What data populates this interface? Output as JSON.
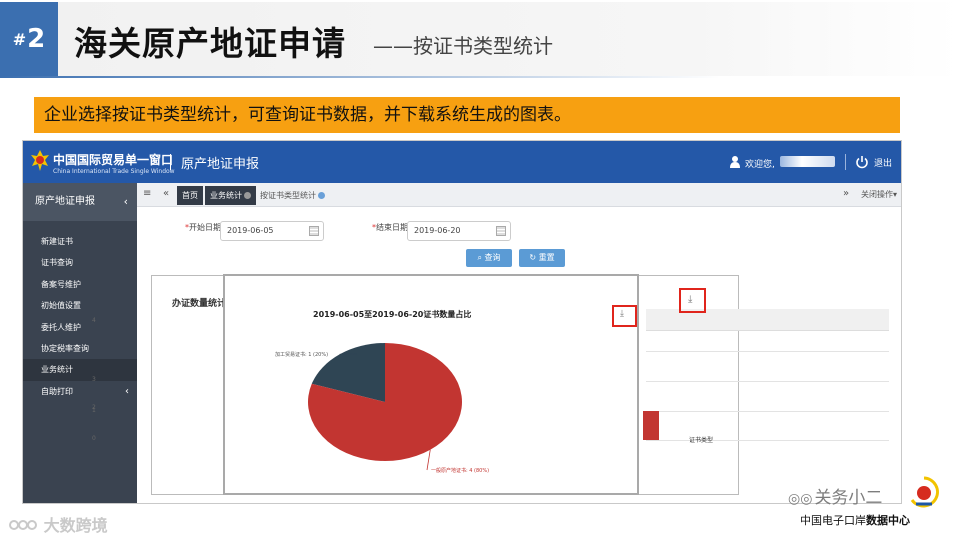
{
  "slide": {
    "number": "2",
    "title": "海关原产地证申请",
    "subtitle": "——按证书类型统计",
    "banner": "企业选择按证书类型统计，可查询证书数据，并下载系统生成的图表。"
  },
  "app": {
    "logo_cn": "中国国际贸易单一窗口",
    "logo_en": "China International Trade Single Window",
    "system_name": "原产地证申报",
    "welcome": "欢迎您,",
    "logout": "退出"
  },
  "sidebar": {
    "header": "原产地证申报",
    "items": [
      {
        "label": "新建证书"
      },
      {
        "label": "证书查询"
      },
      {
        "label": "备案号维护"
      },
      {
        "label": "初始值设置"
      },
      {
        "label": "委托人维护"
      },
      {
        "label": "协定税率查询"
      },
      {
        "label": "业务统计"
      },
      {
        "label": "自助打印"
      }
    ]
  },
  "tabs": {
    "items": [
      {
        "label": "首页"
      },
      {
        "label": "业务统计"
      },
      {
        "label": "按证书类型统计"
      }
    ],
    "close_ops": "关闭操作"
  },
  "form": {
    "start_label": "开始日期",
    "start_value": "2019-06-05",
    "end_label": "结束日期",
    "end_value": "2019-06-20",
    "query": "查询",
    "reset": "重置"
  },
  "stats": {
    "title": "办证数量统计(",
    "axis": [
      "4",
      "3",
      "2",
      "1",
      "0"
    ],
    "x_label": "证书类型"
  },
  "chart_data": {
    "type": "pie",
    "title": "2019-06-05至2019-06-20证书数量占比",
    "slices": [
      {
        "label": "加工贸易证书: 1 (20%)",
        "value": 1,
        "color": "#2f4554"
      },
      {
        "label": "一般原产地证书: 4 (80%)",
        "value": 4,
        "color": "#c23531"
      }
    ]
  },
  "footer": {
    "left_watermark": "大数跨境",
    "right_watermark": "关务小二",
    "org_name": "中国电子口岸",
    "org_suffix": "数据中心"
  }
}
